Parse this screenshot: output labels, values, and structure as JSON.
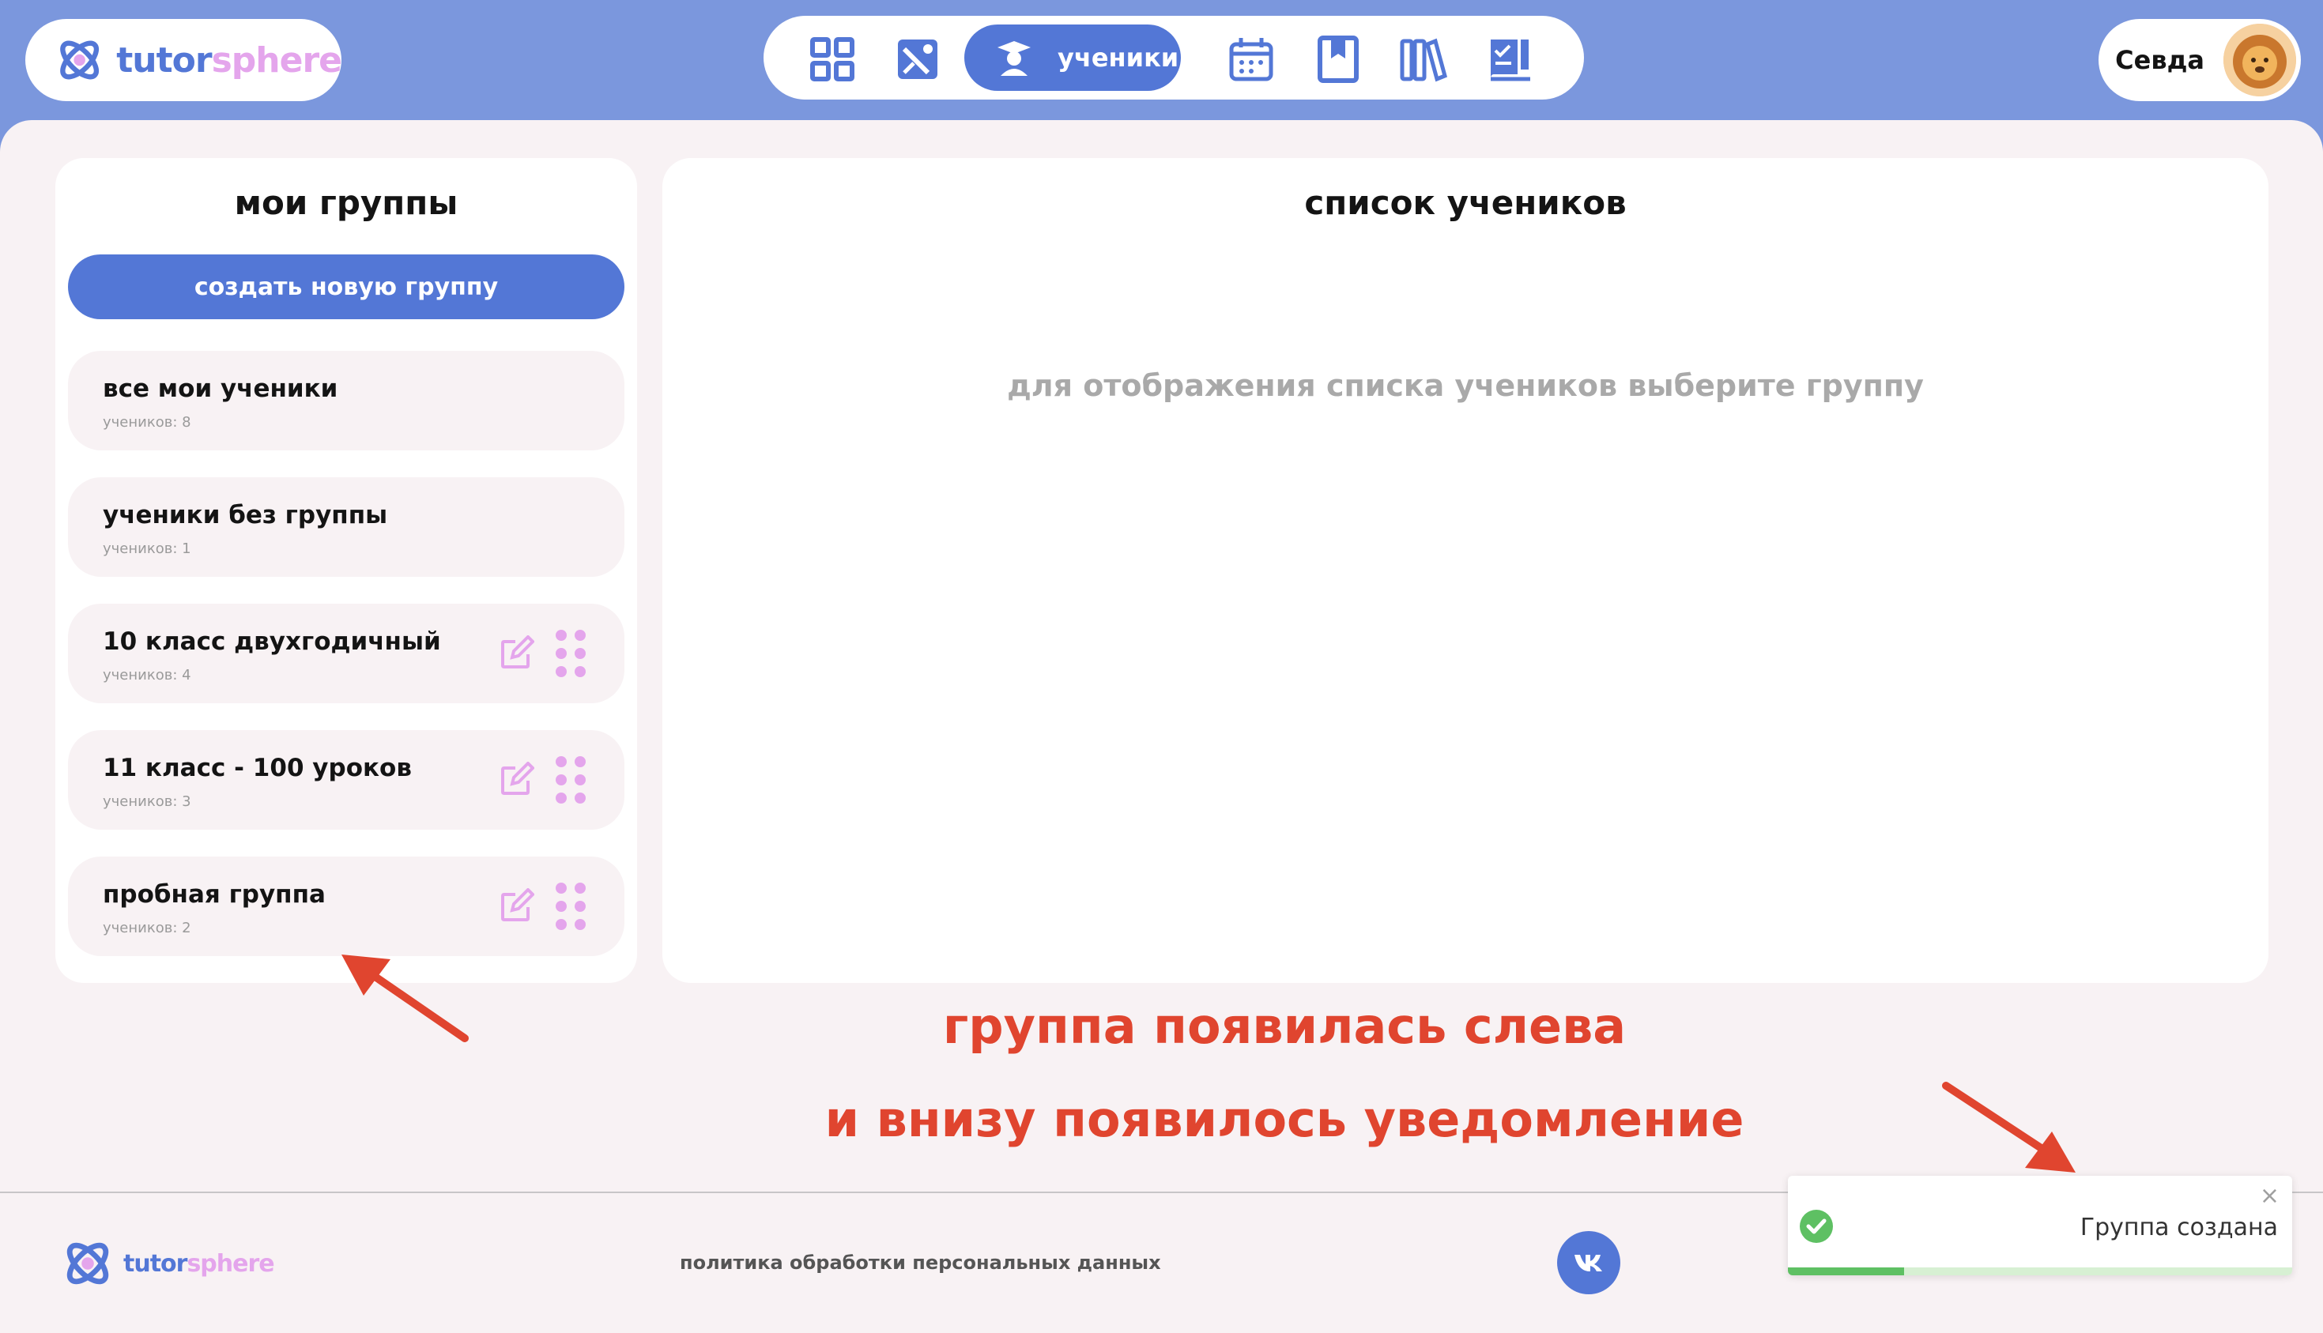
{
  "header": {
    "logo": {
      "part1": "tutor",
      "part2": "sphere"
    },
    "nav": {
      "items": [
        {
          "icon": "dashboard-grid-icon"
        },
        {
          "icon": "tasks-icon"
        },
        {
          "icon": "student-icon",
          "label": "ученики",
          "active": true
        },
        {
          "icon": "calendar-icon"
        },
        {
          "icon": "bookmark-icon"
        },
        {
          "icon": "library-icon"
        },
        {
          "icon": "homework-icon"
        }
      ]
    },
    "user": {
      "name": "Севда",
      "avatar": "lion-avatar-icon"
    }
  },
  "groups_panel": {
    "title": "мои группы",
    "create_label": "создать новую группу",
    "groups": [
      {
        "name": "все мои ученики",
        "count": "учеников: 8",
        "editable": false
      },
      {
        "name": "ученики без группы",
        "count": "учеников: 1",
        "editable": false
      },
      {
        "name": "10 класс двухгодичный",
        "count": "учеников: 4",
        "editable": true
      },
      {
        "name": "11 класс - 100 уроков",
        "count": "учеников: 3",
        "editable": true
      },
      {
        "name": "пробная группа",
        "count": "учеников: 2",
        "editable": true
      }
    ]
  },
  "students_panel": {
    "title": "список учеников",
    "placeholder": "для отображения списка учеников выберите группу"
  },
  "annotation": {
    "line1": "группа появилась слева",
    "line2": "и внизу появилось уведомление"
  },
  "footer": {
    "logo": {
      "part1": "tutor",
      "part2": "sphere"
    },
    "policy": "политика обработки персональных данных",
    "vk_icon": "vk-icon"
  },
  "toast": {
    "message": "Группа создана",
    "close": "×",
    "progress": 0.23
  },
  "colors": {
    "accent": "#5377d6",
    "header_bg": "#7b97dd",
    "pink": "#e4a5ec",
    "annotation": "#e0452f",
    "success": "#5ec063"
  }
}
